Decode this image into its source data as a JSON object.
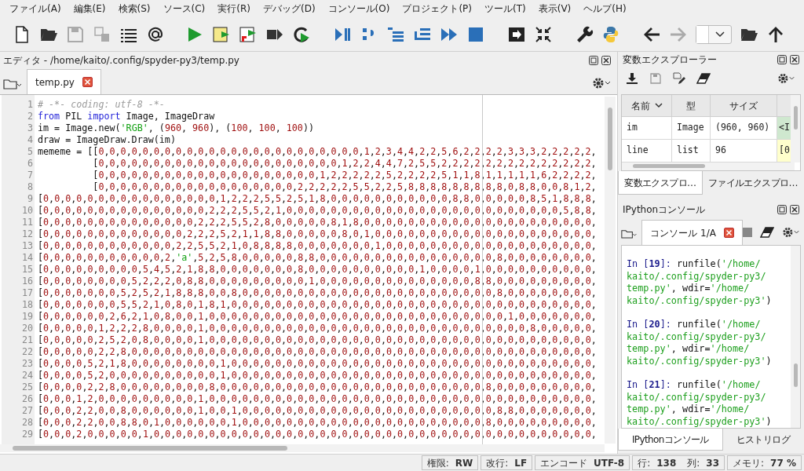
{
  "menu": [
    "ファイル(A)",
    "編集(E)",
    "検索(S)",
    "ソース(C)",
    "実行(R)",
    "デバッグ(D)",
    "コンソール(O)",
    "プロジェクト(P)",
    "ツール(T)",
    "表示(V)",
    "ヘルプ(H)"
  ],
  "editor": {
    "title": "エディタ - /home/kaito/.config/spyder-py3/temp.py",
    "tabs": [
      {
        "label": "temp.py",
        "selected": true
      }
    ],
    "lines": [
      {
        "number": "1",
        "segments": [
          {
            "kind": "comment",
            "text": "# -*- coding: utf-8 -*-"
          }
        ]
      },
      {
        "number": "2",
        "segments": [
          {
            "kind": "keyword",
            "text": "from"
          },
          {
            "kind": "plain",
            "text": " PIL "
          },
          {
            "kind": "keyword",
            "text": "import"
          },
          {
            "kind": "plain",
            "text": " Image, ImageDraw"
          }
        ]
      },
      {
        "number": "3",
        "segments": [
          {
            "kind": "plain",
            "text": "im = Image.new("
          },
          {
            "kind": "string",
            "text": "'RGB'"
          },
          {
            "kind": "data",
            "text": ", (960, 960), (100, 100, 100))"
          }
        ]
      },
      {
        "number": "4",
        "segments": [
          {
            "kind": "plain",
            "text": "draw = ImageDraw.Draw(im)"
          }
        ]
      },
      {
        "number": "5",
        "segments": [
          {
            "kind": "data",
            "text": "mememe = [[0,0,0,0,0,0,0,0,0,0,0,0,0,0,0,0,0,0,0,0,0,0,0,0,1,2,3,4,4,2,2,5,6,2,2,2,2,3,3,3,2,2,2,2,2,"
          }
        ]
      },
      {
        "number": "6",
        "segments": [
          {
            "kind": "data",
            "text": "          [0,0,0,0,0,0,0,0,0,0,0,0,0,0,0,0,0,0,0,0,0,0,1,2,2,4,4,7,2,5,5,2,2,2,2,2,2,2,2,2,2,2,2,2,2,"
          }
        ]
      },
      {
        "number": "7",
        "segments": [
          {
            "kind": "data",
            "text": "          [0,0,0,0,0,0,0,0,0,0,0,0,0,0,0,0,0,0,0,0,1,2,2,2,2,2,5,2,2,2,2,5,1,1,8,1,1,1,1,1,6,2,2,2,2,"
          }
        ]
      },
      {
        "number": "8",
        "segments": [
          {
            "kind": "data",
            "text": "          [0,0,0,0,0,0,0,0,0,0,0,0,0,0,0,0,0,0,2,2,2,2,2,5,5,2,2,5,8,8,8,8,8,8,8,8,8,0,8,8,0,0,8,1,2,"
          }
        ]
      },
      {
        "number": "9",
        "segments": [
          {
            "kind": "data",
            "text": "[0,0,0,0,0,0,0,0,0,0,0,0,0,0,0,0,1,2,2,2,5,5,2,5,1,8,0,0,0,0,0,0,0,0,0,0,0,8,8,0,0,0,0,0,8,5,1,8,8,8,"
          }
        ]
      },
      {
        "number": "10",
        "segments": [
          {
            "kind": "data",
            "text": "[0,0,0,0,0,0,0,0,0,0,0,0,0,0,0,2,2,2,5,5,2,1,0,0,0,0,0,0,0,0,0,0,0,0,0,0,0,0,0,0,0,0,0,0,0,0,0,5,8,8,"
          }
        ]
      },
      {
        "number": "11",
        "segments": [
          {
            "kind": "data",
            "text": "[0,0,0,0,0,0,0,0,0,0,0,0,0,0,2,2,2,5,5,2,8,0,0,0,0,0,8,1,8,0,0,0,0,0,0,0,0,0,0,0,0,0,0,0,0,0,0,0,0,0,"
          }
        ]
      },
      {
        "number": "12",
        "segments": [
          {
            "kind": "data",
            "text": "[0,0,0,0,0,0,0,0,0,0,0,0,0,2,2,2,5,2,1,1,8,8,0,0,0,0,0,8,0,1,0,0,0,0,0,0,0,0,0,0,0,0,0,0,0,0,0,0,0,0,"
          }
        ]
      },
      {
        "number": "13",
        "segments": [
          {
            "kind": "data",
            "text": "[0,0,0,0,0,0,0,0,0,0,0,0,2,2,5,5,2,1,0,8,8,8,8,0,0,0,0,0,0,0,1,0,0,0,0,0,0,0,0,0,0,0,0,0,0,0,0,0,0,0,"
          }
        ]
      },
      {
        "number": "14",
        "segments": [
          {
            "kind": "data",
            "text": "[0,0,0,0,0,0,0,0,0,0,0,2,"
          },
          {
            "kind": "string",
            "text": "'a'"
          },
          {
            "kind": "data",
            "text": ",5,2,5,8,0,0,0,0,0,8,8,0,0,0,0,0,0,0,0,0,0,0,0,0,0,0,0,8,0,0,0,0,0,0,0,0,"
          }
        ]
      },
      {
        "number": "15",
        "segments": [
          {
            "kind": "data",
            "text": "[0,0,0,0,0,0,0,0,0,5,4,5,2,1,8,8,0,0,0,0,0,0,0,8,0,0,0,0,0,0,0,0,0,0,1,0,0,0,0,1,0,0,0,0,0,0,0,0,0,0,"
          }
        ]
      },
      {
        "number": "16",
        "segments": [
          {
            "kind": "data",
            "text": "[0,0,0,0,0,0,0,0,5,2,2,2,0,8,8,0,0,0,0,0,0,0,0,0,1,0,0,0,0,0,0,0,0,0,0,0,0,0,0,8,8,0,0,0,0,0,0,0,0,0,"
          }
        ]
      },
      {
        "number": "17",
        "segments": [
          {
            "kind": "data",
            "text": "[0,0,0,0,0,0,0,5,2,5,2,1,8,8,8,0,0,8,0,0,0,0,0,0,0,0,0,0,0,0,0,0,0,0,0,0,0,0,0,0,0,8,0,0,0,0,0,0,0,0,"
          }
        ]
      },
      {
        "number": "18",
        "segments": [
          {
            "kind": "data",
            "text": "[0,0,0,0,0,0,0,5,5,2,1,0,8,0,1,8,1,0,0,0,0,0,0,0,0,0,0,0,0,0,0,0,0,0,0,0,0,0,0,0,0,0,0,0,0,0,0,0,0,0,"
          }
        ]
      },
      {
        "number": "19",
        "segments": [
          {
            "kind": "data",
            "text": "[0,0,0,0,0,0,2,6,2,1,0,8,0,0,1,0,0,0,0,0,0,0,0,0,0,0,0,0,0,0,0,0,0,0,0,0,0,0,0,0,0,0,1,0,0,0,0,0,0,0,"
          }
        ]
      },
      {
        "number": "20",
        "segments": [
          {
            "kind": "data",
            "text": "[0,0,0,0,0,1,2,2,2,8,0,0,0,0,1,0,0,0,0,0,0,0,0,0,0,0,0,0,0,0,0,0,0,0,0,0,0,0,0,0,0,0,0,0,8,0,0,0,0,0,"
          }
        ]
      },
      {
        "number": "21",
        "segments": [
          {
            "kind": "data",
            "text": "[0,0,0,0,0,2,5,2,0,8,0,0,0,0,1,0,0,0,0,0,0,0,0,0,0,0,0,0,0,0,0,0,0,0,0,0,0,0,0,0,0,0,0,0,0,0,0,0,0,0,"
          }
        ]
      },
      {
        "number": "22",
        "segments": [
          {
            "kind": "data",
            "text": "[0,0,0,0,0,2,2,8,0,0,0,0,0,0,0,0,0,0,0,0,0,0,0,0,0,0,0,0,0,0,0,0,0,0,0,0,0,0,0,0,0,0,0,0,0,0,0,0,0,0,"
          }
        ]
      },
      {
        "number": "23",
        "segments": [
          {
            "kind": "data",
            "text": "[0,0,0,0,5,2,1,8,0,0,0,0,0,0,0,0,1,0,0,0,0,0,0,0,0,0,0,0,0,0,0,0,0,0,0,0,0,0,0,0,0,0,0,0,0,0,0,0,0,0,"
          }
        ]
      },
      {
        "number": "24",
        "segments": [
          {
            "kind": "data",
            "text": "[0,0,0,0,5,2,0,0,0,0,0,0,0,0,0,0,1,0,0,0,0,0,0,0,0,0,0,0,0,0,0,0,0,0,0,0,0,0,0,0,0,0,0,0,0,0,0,0,0,0,"
          }
        ]
      },
      {
        "number": "25",
        "segments": [
          {
            "kind": "data",
            "text": "[0,0,0,0,2,2,8,0,0,0,0,0,0,0,0,8,0,0,0,0,0,0,0,0,0,0,0,0,0,0,0,0,0,0,0,0,0,0,0,0,8,0,0,0,0,0,0,0,0,0,"
          }
        ]
      },
      {
        "number": "26",
        "segments": [
          {
            "kind": "data",
            "text": "[0,0,0,1,2,0,0,0,0,0,0,0,0,0,1,0,0,0,0,0,0,0,0,0,0,0,0,0,0,0,0,0,0,0,0,0,0,0,0,0,0,0,0,0,0,0,0,0,0,0,"
          }
        ]
      },
      {
        "number": "27",
        "segments": [
          {
            "kind": "data",
            "text": "[0,0,0,2,2,0,0,8,0,0,0,0,0,0,1,0,0,1,0,0,0,0,0,0,0,0,0,0,0,0,0,0,0,0,0,0,0,0,0,0,0,8,8,0,0,0,0,0,0,0,"
          }
        ]
      },
      {
        "number": "28",
        "segments": [
          {
            "kind": "data",
            "text": "[0,0,0,2,2,0,0,8,8,0,1,0,0,0,0,0,0,1,0,0,0,0,0,0,0,0,0,0,0,0,0,0,0,0,0,0,0,0,0,0,8,0,0,0,0,0,0,0,0,0,"
          }
        ]
      },
      {
        "number": "29",
        "segments": [
          {
            "kind": "data",
            "text": "[0,0,0,2,0,0,0,0,0,1,0,0,0,0,0,0,0,0,0,0,0,0,0,0,0,0,0,0,0,0,0,0,0,0,0,0,0,0,0,0,0,0,0,0,0,0,0,0,0,0,"
          }
        ]
      }
    ]
  },
  "variable_explorer": {
    "title": "変数エクスプローラー",
    "columns": [
      "名前",
      "型",
      "サイズ"
    ],
    "rows": [
      {
        "name": "im",
        "type": "Image",
        "size": "(960, 960)",
        "value": "<I",
        "color": "#cfe8cf"
      },
      {
        "name": "line",
        "type": "list",
        "size": "96",
        "value": "[0",
        "color": "#ffffcc"
      }
    ],
    "tabs": [
      {
        "label": "変数エクスプロ…",
        "selected": true
      },
      {
        "label": "ファイルエクスプロ…",
        "selected": false
      }
    ]
  },
  "console": {
    "title": "IPythonコンソール",
    "tabs": [
      {
        "label": "コンソール 1/A",
        "selected": true
      }
    ],
    "entries": [
      {
        "lines": [
          [
            {
              "kind": "prompt",
              "text": "In ["
            },
            {
              "kind": "count",
              "text": "19"
            },
            {
              "kind": "prompt",
              "text": "]: "
            },
            {
              "kind": "plain",
              "text": "runfile("
            },
            {
              "kind": "string",
              "text": "'/home/"
            }
          ],
          [
            {
              "kind": "string",
              "text": "kaito/.config/spyder-py3/"
            }
          ],
          [
            {
              "kind": "string",
              "text": "temp.py'"
            },
            {
              "kind": "plain",
              "text": ", wdir="
            },
            {
              "kind": "string",
              "text": "'/home/"
            }
          ],
          [
            {
              "kind": "string",
              "text": "kaito/.config/spyder-py3'"
            },
            {
              "kind": "plain",
              "text": ")"
            }
          ]
        ]
      },
      {
        "lines": [
          [
            {
              "kind": "prompt",
              "text": "In ["
            },
            {
              "kind": "count",
              "text": "20"
            },
            {
              "kind": "prompt",
              "text": "]: "
            },
            {
              "kind": "plain",
              "text": "runfile("
            },
            {
              "kind": "string",
              "text": "'/home/"
            }
          ],
          [
            {
              "kind": "string",
              "text": "kaito/.config/spyder-py3/"
            }
          ],
          [
            {
              "kind": "string",
              "text": "temp.py'"
            },
            {
              "kind": "plain",
              "text": ", wdir="
            },
            {
              "kind": "string",
              "text": "'/home/"
            }
          ],
          [
            {
              "kind": "string",
              "text": "kaito/.config/spyder-py3'"
            },
            {
              "kind": "plain",
              "text": ")"
            }
          ]
        ]
      },
      {
        "lines": [
          [
            {
              "kind": "prompt",
              "text": "In ["
            },
            {
              "kind": "count",
              "text": "21"
            },
            {
              "kind": "prompt",
              "text": "]: "
            },
            {
              "kind": "plain",
              "text": "runfile("
            },
            {
              "kind": "string",
              "text": "'/home/"
            }
          ],
          [
            {
              "kind": "string",
              "text": "kaito/.config/spyder-py3/"
            }
          ],
          [
            {
              "kind": "string",
              "text": "temp.py'"
            },
            {
              "kind": "plain",
              "text": ", wdir="
            },
            {
              "kind": "string",
              "text": "'/home/"
            }
          ],
          [
            {
              "kind": "string",
              "text": "kaito/.config/spyder-py3'"
            },
            {
              "kind": "plain",
              "text": ")"
            }
          ]
        ]
      }
    ],
    "bottom_tabs": [
      {
        "label": "IPythonコンソール",
        "selected": true
      },
      {
        "label": "ヒストリログ",
        "selected": false
      }
    ]
  },
  "status_bar": [
    {
      "fields": [
        {
          "label": "権限:",
          "value": "RW"
        }
      ]
    },
    {
      "fields": [
        {
          "label": "改行:",
          "value": "LF"
        }
      ]
    },
    {
      "fields": [
        {
          "label": "エンコード",
          "value": "UTF-8"
        }
      ]
    },
    {
      "fields": [
        {
          "label": "行:",
          "value": "138"
        },
        {
          "label": "列:",
          "value": "33"
        }
      ]
    },
    {
      "fields": [
        {
          "label": "メモリ:",
          "value": "77 %"
        }
      ]
    }
  ]
}
